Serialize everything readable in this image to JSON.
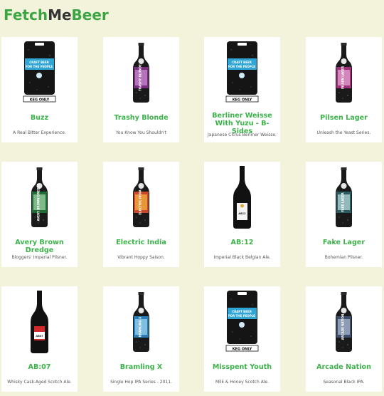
{
  "brand": {
    "part1": "Fetch",
    "part2": "Me",
    "part3": "Beer"
  },
  "colors": {
    "accent": "#3bb34a",
    "background": "#f3f3dc",
    "card": "#ffffff"
  },
  "keg_label": "KEG ONLY",
  "keg_text": "CRAFT BEER FOR THE PEOPLE",
  "beers": [
    {
      "name": "Buzz",
      "desc": "A Real Bitter Experience.",
      "image": "keg"
    },
    {
      "name": "Trashy Blonde",
      "desc": "You Know You Shouldn't",
      "image": "bottle-purple",
      "label_text": "TRASHY BLONDE"
    },
    {
      "name": "Berliner Weisse With Yuzu - B-Sides",
      "desc": "Japanese Citrus Berliner Weisse.",
      "image": "keg"
    },
    {
      "name": "Pilsen Lager",
      "desc": "Unleash the Yeast Series.",
      "image": "bottle-magenta",
      "label_text": "PILSEN LAGER"
    },
    {
      "name": "Avery Brown Dredge",
      "desc": "Bloggers' Imperial Pilsner.",
      "image": "bottle-green",
      "label_text": "AVERY BROWN DREDGE"
    },
    {
      "name": "Electric India",
      "desc": "Vibrant Hoppy Saison.",
      "image": "bottle-orange",
      "label_text": "ELECTRIC INDIA"
    },
    {
      "name": "AB:12",
      "desc": "Imperial Black Belgian Ale.",
      "image": "tall-bottle-white",
      "label_text": "AB12"
    },
    {
      "name": "Fake Lager",
      "desc": "Bohemian Pilsner.",
      "image": "bottle-teal",
      "label_text": "FAKE LAGER"
    },
    {
      "name": "AB:07",
      "desc": "Whisky Cask-Aged Scotch Ale.",
      "image": "tall-bottle-red",
      "label_text": "AB07"
    },
    {
      "name": "Bramling X",
      "desc": "Single Hop IPA Series - 2011.",
      "image": "bottle-blue",
      "label_text": "BRAMLING X"
    },
    {
      "name": "Misspent Youth",
      "desc": "Milk & Honey Scotch Ale.",
      "image": "keg"
    },
    {
      "name": "Arcade Nation",
      "desc": "Seasonal Black IPA.",
      "image": "bottle-steel",
      "label_text": "ARCADE NATION"
    }
  ]
}
